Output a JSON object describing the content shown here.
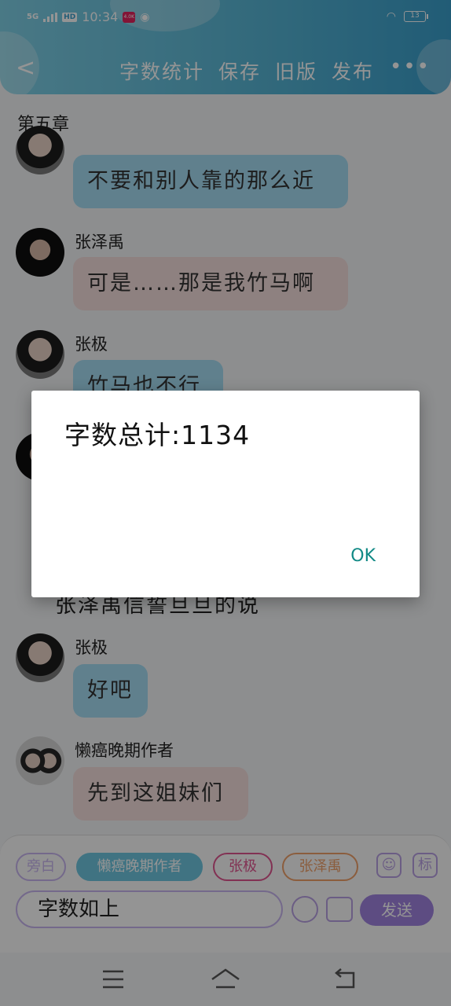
{
  "status_bar": {
    "network": "5G",
    "hd": "HD",
    "time": "10:34",
    "badge": "4.0K",
    "battery": "13"
  },
  "header": {
    "back_label": "<",
    "menu": [
      "字数统计",
      "保存",
      "旧版",
      "发布"
    ],
    "more_label": "•••"
  },
  "chapter_title": "第五章",
  "chat": {
    "messages": [
      {
        "text": "不要和别人靠的那么近"
      },
      {
        "name": "张泽禹",
        "text": "可是……那是我竹马啊"
      },
      {
        "name": "张极",
        "text": "竹马也不行"
      },
      {
        "narration": "张泽禹信誓旦旦的说"
      },
      {
        "name": "张极",
        "text": "好吧"
      },
      {
        "name": "懒癌晚期作者",
        "text": "先到这姐妹们"
      }
    ]
  },
  "composer": {
    "roles": [
      "旁白",
      "懒癌晚期作者",
      "张极",
      "张泽禹"
    ],
    "icon_label": "标",
    "input_value": "字数如上",
    "send_label": "发送"
  },
  "dialog": {
    "message": "字数总计:1134",
    "ok_label": "OK"
  },
  "colors": {
    "header": "#4fb0d6",
    "bubble_blue": "#a6dcf3",
    "bubble_pink": "#f5dedd",
    "accent_purple": "#a183e0",
    "ok_teal": "#128a86"
  }
}
